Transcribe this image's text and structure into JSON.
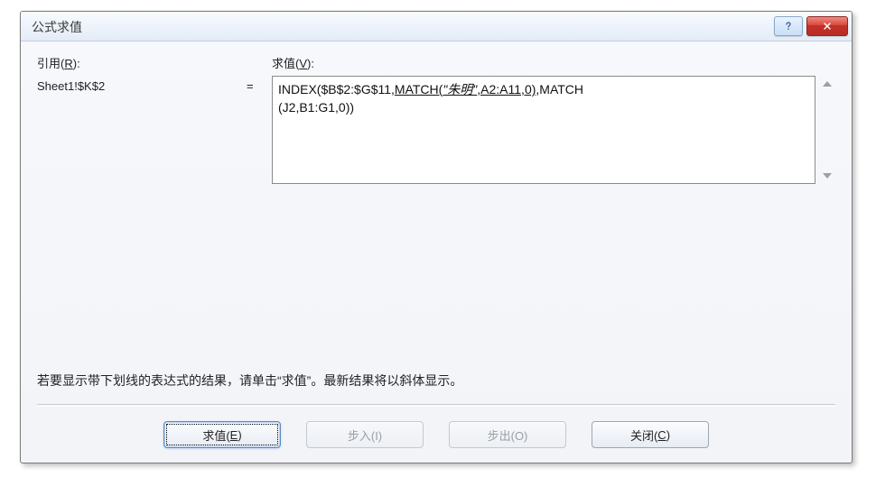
{
  "dialog": {
    "title": "公式求值"
  },
  "labels": {
    "reference": "引用(",
    "reference_key": "R",
    "reference_after": "):",
    "evaluation": "求值(",
    "evaluation_key": "V",
    "evaluation_after": "):"
  },
  "reference_value": "Sheet1!$K$2",
  "equals": "=",
  "formula": {
    "pre": "INDEX($B$2:$G$11,",
    "underlined": "MATCH(",
    "italic_arg": "\"朱明\"",
    "underlined_tail": ",A2:A11,0)",
    "post_line1": ",MATCH",
    "line2": "(J2,B1:G1,0))"
  },
  "hint": "若要显示带下划线的表达式的结果，请单击“求值”。最新结果将以斜体显示。",
  "buttons": {
    "evaluate": "求值(",
    "evaluate_key": "E",
    "evaluate_after": ")",
    "step_in": "步入(I)",
    "step_out": "步出(O)",
    "close": "关闭(",
    "close_key": "C",
    "close_after": ")"
  }
}
